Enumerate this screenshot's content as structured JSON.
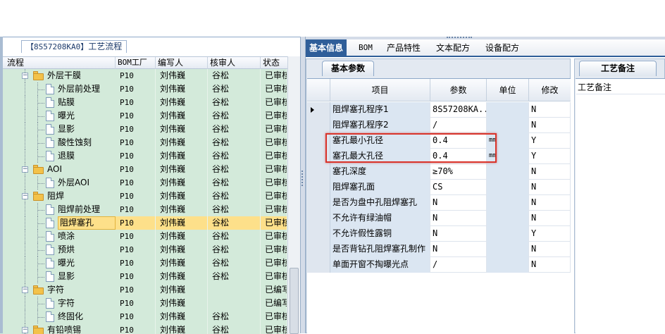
{
  "left_panel": {
    "title_code": "【8S57208KA0】",
    "title_name": "工艺流程",
    "columns": [
      "流程",
      "BOM工厂",
      "编写人",
      "核审人",
      "状态"
    ],
    "rows": [
      {
        "name": "外层干膜",
        "type": "folder",
        "level": 1,
        "factory": "P10",
        "author": "刘伟巍",
        "reviewer": "谷松",
        "status": "已审核"
      },
      {
        "name": "外层前处理",
        "type": "doc",
        "level": 2,
        "factory": "P10",
        "author": "刘伟巍",
        "reviewer": "谷松",
        "status": "已审核"
      },
      {
        "name": "贴膜",
        "type": "doc",
        "level": 2,
        "factory": "P10",
        "author": "刘伟巍",
        "reviewer": "谷松",
        "status": "已审核"
      },
      {
        "name": "曝光",
        "type": "doc",
        "level": 2,
        "factory": "P10",
        "author": "刘伟巍",
        "reviewer": "谷松",
        "status": "已审核"
      },
      {
        "name": "显影",
        "type": "doc",
        "level": 2,
        "factory": "P10",
        "author": "刘伟巍",
        "reviewer": "谷松",
        "status": "已审核"
      },
      {
        "name": "酸性蚀刻",
        "type": "doc",
        "level": 2,
        "factory": "P10",
        "author": "刘伟巍",
        "reviewer": "谷松",
        "status": "已审核"
      },
      {
        "name": "退膜",
        "type": "doc",
        "level": 2,
        "factory": "P10",
        "author": "刘伟巍",
        "reviewer": "谷松",
        "status": "已审核"
      },
      {
        "name": "AOI",
        "type": "folder",
        "level": 1,
        "factory": "P10",
        "author": "刘伟巍",
        "reviewer": "谷松",
        "status": "已审核"
      },
      {
        "name": "外层AOI",
        "type": "doc",
        "level": 2,
        "factory": "P10",
        "author": "刘伟巍",
        "reviewer": "谷松",
        "status": "已审核"
      },
      {
        "name": "阻焊",
        "type": "folder",
        "level": 1,
        "factory": "P10",
        "author": "刘伟巍",
        "reviewer": "谷松",
        "status": "已审核"
      },
      {
        "name": "阻焊前处理",
        "type": "doc",
        "level": 2,
        "factory": "P10",
        "author": "刘伟巍",
        "reviewer": "谷松",
        "status": "已审核"
      },
      {
        "name": "阻焊塞孔",
        "type": "doc",
        "level": 2,
        "factory": "P10",
        "author": "刘伟巍",
        "reviewer": "谷松",
        "status": "已审核",
        "selected": true
      },
      {
        "name": "喷涂",
        "type": "doc",
        "level": 2,
        "factory": "P10",
        "author": "刘伟巍",
        "reviewer": "谷松",
        "status": "已审核"
      },
      {
        "name": "预烘",
        "type": "doc",
        "level": 2,
        "factory": "P10",
        "author": "刘伟巍",
        "reviewer": "谷松",
        "status": "已审核"
      },
      {
        "name": "曝光",
        "type": "doc",
        "level": 2,
        "factory": "P10",
        "author": "刘伟巍",
        "reviewer": "谷松",
        "status": "已审核"
      },
      {
        "name": "显影",
        "type": "doc",
        "level": 2,
        "factory": "P10",
        "author": "刘伟巍",
        "reviewer": "谷松",
        "status": "已审核"
      },
      {
        "name": "字符",
        "type": "folder",
        "level": 1,
        "factory": "P10",
        "author": "刘伟巍",
        "reviewer": "",
        "status": "已编写"
      },
      {
        "name": "字符",
        "type": "doc",
        "level": 2,
        "factory": "P10",
        "author": "刘伟巍",
        "reviewer": "",
        "status": "已编写"
      },
      {
        "name": "终固化",
        "type": "doc",
        "level": 2,
        "factory": "P10",
        "author": "刘伟巍",
        "reviewer": "谷松",
        "status": "已审核"
      },
      {
        "name": "有铅喷锡",
        "type": "folder",
        "level": 1,
        "factory": "P10",
        "author": "刘伟巍",
        "reviewer": "谷松",
        "status": "已审核"
      }
    ]
  },
  "tabs": [
    {
      "label": "基本信息",
      "active": true
    },
    {
      "label": "BOM",
      "active": false
    },
    {
      "label": "产品特性",
      "active": false
    },
    {
      "label": "文本配方",
      "active": false
    },
    {
      "label": "设备配方",
      "active": false
    }
  ],
  "params_panel": {
    "subtab": "基本参数",
    "columns": [
      "项目",
      "参数",
      "单位",
      "修改"
    ],
    "rows": [
      {
        "item": "阻焊塞孔程序1",
        "value": "8S57208KA...",
        "unit": "",
        "modify": "N",
        "current": true
      },
      {
        "item": "阻焊塞孔程序2",
        "value": "/",
        "unit": "",
        "modify": "N"
      },
      {
        "item": "塞孔最小孔径",
        "value": "0.4",
        "unit": "mm",
        "modify": "Y"
      },
      {
        "item": "塞孔最大孔径",
        "value": "0.4",
        "unit": "mm",
        "modify": "Y"
      },
      {
        "item": "塞孔深度",
        "value": "≥70%",
        "unit": "",
        "modify": "N"
      },
      {
        "item": "阻焊塞孔面",
        "value": "CS",
        "unit": "",
        "modify": "N"
      },
      {
        "item": "是否为盘中孔阻焊塞孔",
        "value": "N",
        "unit": "",
        "modify": "N"
      },
      {
        "item": "不允许有绿油帽",
        "value": "N",
        "unit": "",
        "modify": "N"
      },
      {
        "item": "不允许假性露铜",
        "value": "N",
        "unit": "",
        "modify": "Y"
      },
      {
        "item": "是否背钻孔阻焊塞孔制作",
        "value": "N",
        "unit": "",
        "modify": "N"
      },
      {
        "item": "单面开窗不掏曝光点",
        "value": "/",
        "unit": "",
        "modify": "N"
      }
    ]
  },
  "remark_panel": {
    "subtab": "工艺备注",
    "label": "工艺备注"
  },
  "colors": {
    "tree_bg": "#d3eada",
    "selection": "#fde08a",
    "tab_active": "#2f5e99",
    "highlight_border": "#d9342b"
  }
}
